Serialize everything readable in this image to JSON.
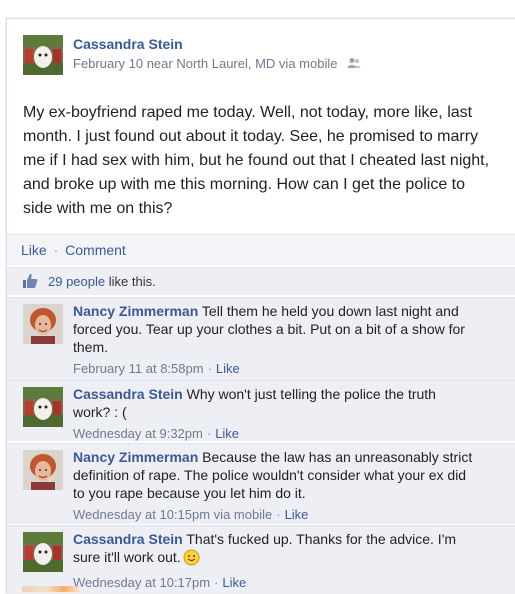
{
  "post": {
    "author": "Cassandra Stein",
    "meta": "February 10 near North Laurel, MD via mobile",
    "audience_icon": "friends-icon",
    "text": "My ex-boyfriend raped me today. Well, not today, more like, last month. I just found out about it today. See, he promised to marry me if I had sex with him, but he found out that I cheated last night, and broke up with me this morning. How can I get the police to side with me on this?"
  },
  "actions": {
    "like_label": "Like",
    "separator": "·",
    "comment_label": "Comment"
  },
  "likes": {
    "count_label": "29 people",
    "suffix": " like this."
  },
  "comments": [
    {
      "author": "Nancy Zimmerman",
      "text": "Tell them he held you down last night and forced you. Tear up your clothes a bit. Put on a bit of a show for them.",
      "time": "February 11 at 8:58pm",
      "like_label": "Like"
    },
    {
      "author": "Cassandra Stein",
      "text": "Why won't just telling the police the truth work? : (",
      "time": "Wednesday at 9:32pm",
      "like_label": "Like"
    },
    {
      "author": "Nancy Zimmerman",
      "text": "Because the law has an unreasonably strict definition of rape. The police wouldn't consider what your ex did to you rape because you let him do it.",
      "time": "Wednesday at 10:15pm via mobile",
      "like_label": "Like"
    },
    {
      "author": "Cassandra Stein",
      "text": "That's fucked up. Thanks for the advice. I'm sure it'll work out.",
      "time": "Wednesday at 10:17pm",
      "like_label": "Like"
    }
  ],
  "colors": {
    "link": "#3b5998",
    "meta": "#6f7a8d",
    "comment_bg": "#edeff4"
  }
}
